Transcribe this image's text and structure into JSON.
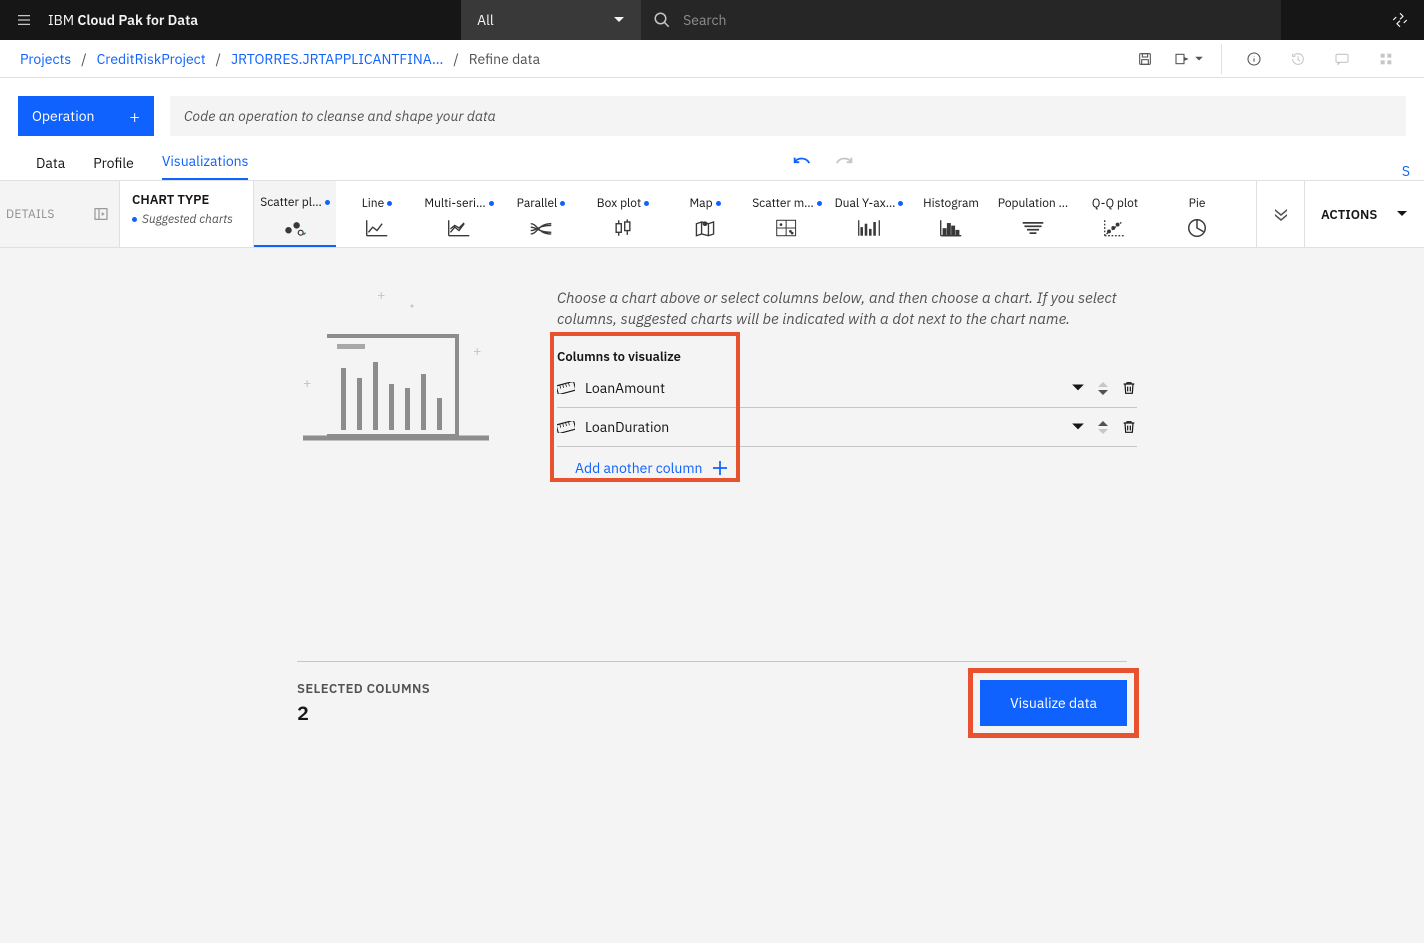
{
  "header": {
    "brand_light": "IBM ",
    "brand_bold": "Cloud Pak for Data",
    "filter": "All",
    "search_placeholder": "Search"
  },
  "breadcrumb": {
    "root": "Projects",
    "project": "CreditRiskProject",
    "asset": "JRTORRES.JRTAPPLICANTFINA...",
    "current": "Refine data"
  },
  "operation": {
    "button": "Operation",
    "placeholder": "Code an operation to cleanse and shape your data"
  },
  "tabs": {
    "data": "Data",
    "profile": "Profile",
    "visualizations": "Visualizations"
  },
  "chart_bar": {
    "details": "DETAILS",
    "chart_type": "CHART TYPE",
    "suggested": "Suggested charts",
    "actions": "ACTIONS",
    "items": [
      {
        "label": "Scatter pl…",
        "suggested": true
      },
      {
        "label": "Line",
        "suggested": true
      },
      {
        "label": "Multi-seri…",
        "suggested": true
      },
      {
        "label": "Parallel",
        "suggested": true
      },
      {
        "label": "Box plot",
        "suggested": true
      },
      {
        "label": "Map",
        "suggested": true
      },
      {
        "label": "Scatter m…",
        "suggested": true
      },
      {
        "label": "Dual Y-ax…",
        "suggested": true
      },
      {
        "label": "Histogram",
        "suggested": false
      },
      {
        "label": "Population …",
        "suggested": false
      },
      {
        "label": "Q-Q plot",
        "suggested": false
      },
      {
        "label": "Pie",
        "suggested": false
      }
    ]
  },
  "main": {
    "instruction": "Choose a chart above or select columns below, and then choose a chart. If you select columns, suggested charts will be indicated with a dot next to the chart name.",
    "columns_header": "Columns to visualize",
    "columns": [
      "LoanAmount",
      "LoanDuration"
    ],
    "add_column": "Add another column",
    "selected_label": "SELECTED COLUMNS",
    "selected_count": "2",
    "visualize_button": "Visualize data"
  }
}
